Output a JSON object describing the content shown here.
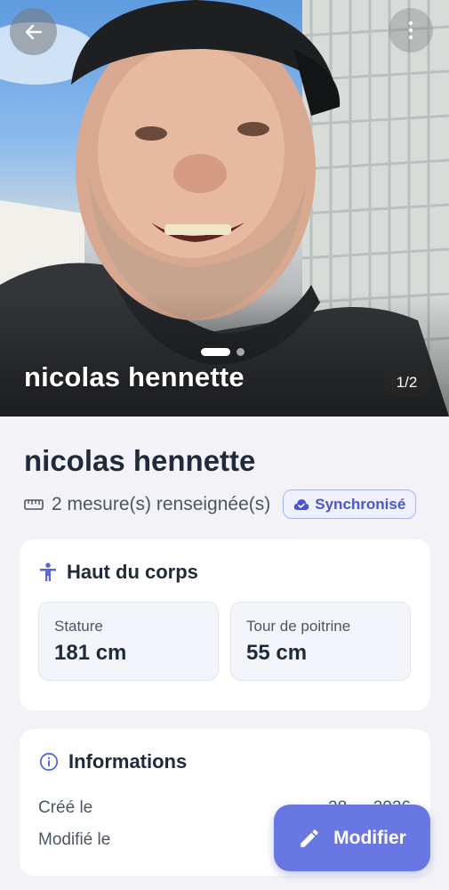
{
  "hero": {
    "name": "nicolas hennette",
    "counter": "1/2",
    "photo_count": 2,
    "active_photo_index": 0
  },
  "profile": {
    "name": "nicolas hennette",
    "measure_summary": "2 mesure(s) renseignée(s)",
    "sync_status": "Synchronisé"
  },
  "sections": {
    "upper_body": {
      "title": "Haut du corps",
      "measures": [
        {
          "label": "Stature",
          "value": "181 cm"
        },
        {
          "label": "Tour de poitrine",
          "value": "55 cm"
        }
      ]
    },
    "info": {
      "title": "Informations",
      "created_label": "Créé le",
      "modified_label": "Modifié le",
      "created_value_partial": "28 … 2026"
    }
  },
  "fab": {
    "label": "Modifier"
  },
  "colors": {
    "accent": "#6977e3",
    "sync_text": "#4b57c9",
    "sync_border": "#aab3ee",
    "title_text": "#1f2a3a"
  },
  "icons": {
    "back": "arrow-left-icon",
    "menu": "more-vertical-icon",
    "ruler": "ruler-icon",
    "sync": "cloud-check-icon",
    "body": "person-icon",
    "info": "info-circle-icon",
    "edit": "pencil-icon"
  }
}
